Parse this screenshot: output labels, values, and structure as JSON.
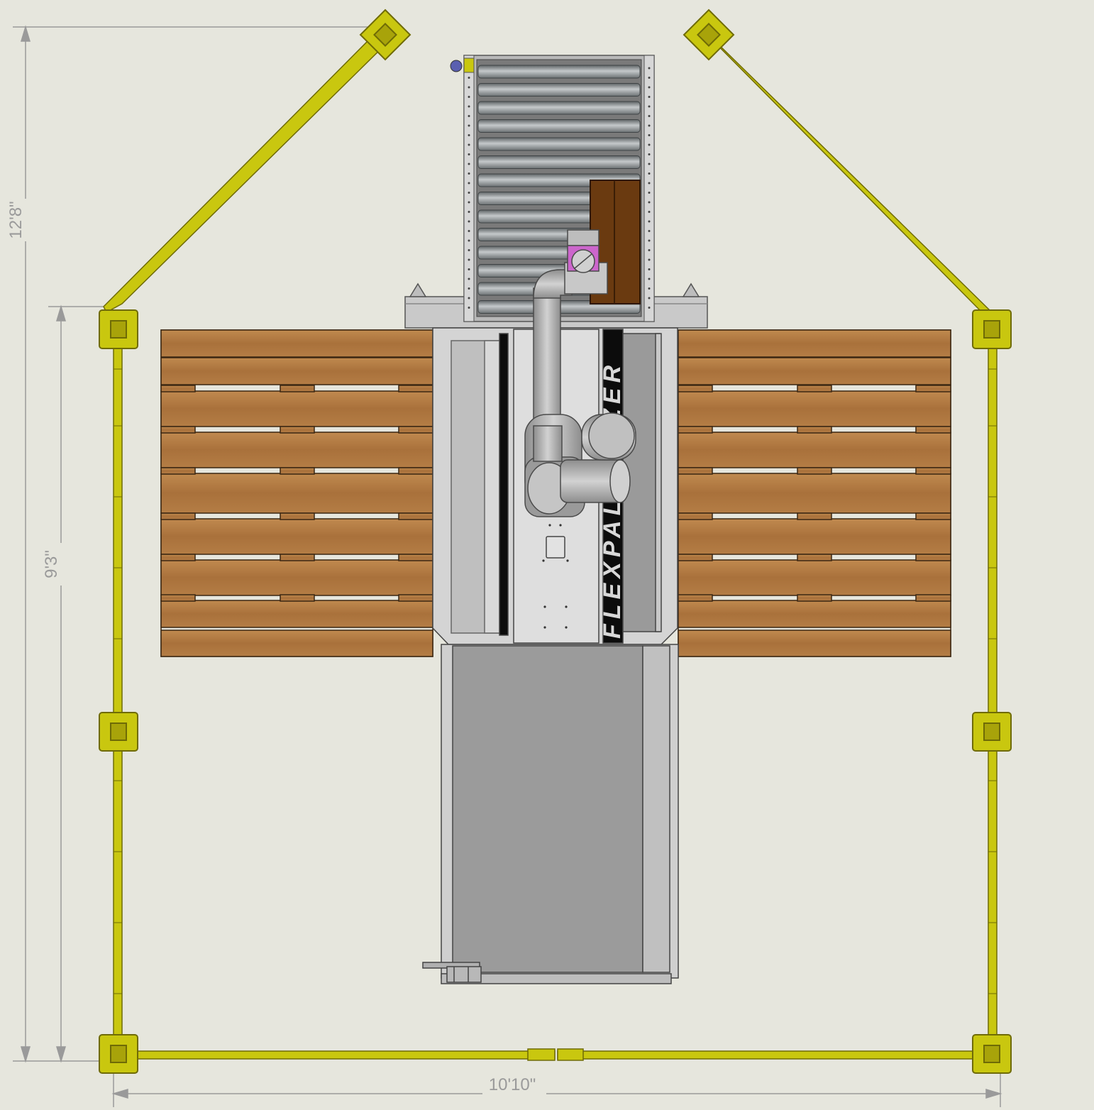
{
  "dimensions": {
    "overall_height": "12'8\"",
    "fence_depth": "9'3\"",
    "overall_width": "10'10\""
  },
  "branding": {
    "text": "FLEXPALLETIZER"
  },
  "colors": {
    "background": "#e6e6dd",
    "fence": "#c9c70f",
    "fence_dark": "#6f6b06",
    "wood_light": "#b47b41",
    "wood_dark": "#8f5a2a",
    "steel": "#b9b9b9",
    "steel_dark": "#8b8b8b",
    "box": "#6a3a10",
    "dimension_line": "#9a9a9a"
  }
}
